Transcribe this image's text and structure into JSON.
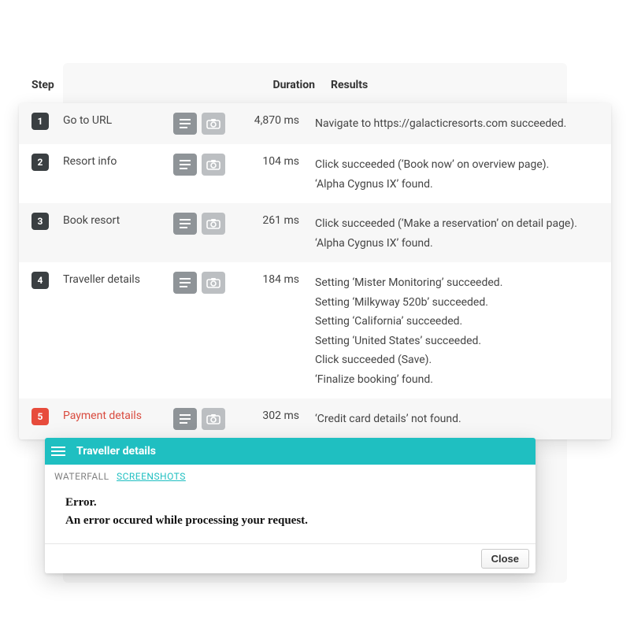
{
  "headers": {
    "step": "Step",
    "duration": "Duration",
    "results": "Results"
  },
  "steps": [
    {
      "num": "1",
      "name": "Go to URL",
      "duration": "4,870 ms",
      "error": false,
      "results": [
        "Navigate to https://galacticresorts.com succeeded."
      ]
    },
    {
      "num": "2",
      "name": "Resort info",
      "duration": "104 ms",
      "error": false,
      "results": [
        "Click succeeded (‘Book now’ on overview page).",
        "‘Alpha Cygnus IX’ found."
      ]
    },
    {
      "num": "3",
      "name": "Book resort",
      "duration": "261 ms",
      "error": false,
      "results": [
        "Click succeeded (‘Make a reservation’ on detail page).",
        "‘Alpha Cygnus IX’ found."
      ]
    },
    {
      "num": "4",
      "name": "Traveller details",
      "duration": "184 ms",
      "error": false,
      "results": [
        "Setting ‘Mister Monitoring’ succeeded.",
        "Setting ‘Milkyway 520b’ succeeded.",
        "Setting ‘California’ succeeded.",
        "Setting ‘United States’ succeeded.",
        "Click succeeded (Save).",
        "‘Finalize booking’ found."
      ]
    },
    {
      "num": "5",
      "name": "Payment details",
      "duration": "302 ms",
      "error": true,
      "results": [
        "‘Credit card details’ not found."
      ]
    }
  ],
  "popup": {
    "title": "Traveller details",
    "tabs": {
      "waterfall": "WATERFALL",
      "screenshots": "SCREENSHOTS"
    },
    "error_title": "Error.",
    "error_message": "An error occured while processing your request.",
    "close_label": "Close"
  }
}
